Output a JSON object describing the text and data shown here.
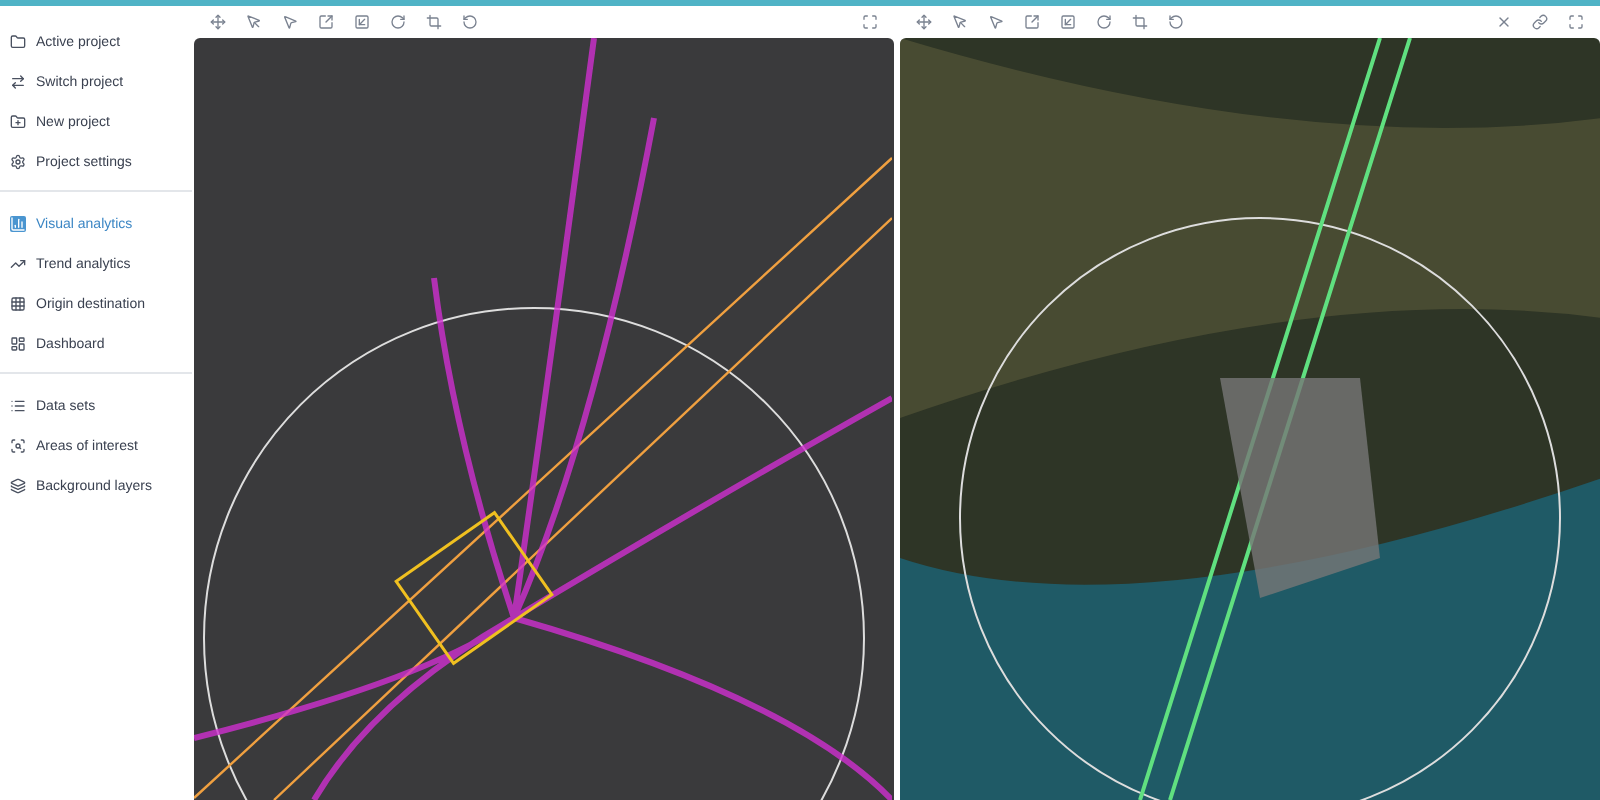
{
  "sidebar": {
    "sections": [
      [
        {
          "label": "Active project",
          "selected": false
        },
        {
          "label": "Switch project",
          "selected": false
        },
        {
          "label": "New project",
          "selected": false
        },
        {
          "label": "Project settings",
          "selected": false
        }
      ],
      [
        {
          "label": "Visual analytics",
          "selected": true
        },
        {
          "label": "Trend analytics",
          "selected": false
        },
        {
          "label": "Origin destination",
          "selected": false
        },
        {
          "label": "Dashboard",
          "selected": false
        }
      ],
      [
        {
          "label": "Data sets",
          "selected": false
        },
        {
          "label": "Areas of interest",
          "selected": false
        },
        {
          "label": "Background layers",
          "selected": false
        }
      ]
    ]
  },
  "panels": [
    {
      "kind": "street"
    },
    {
      "kind": "satellite"
    }
  ]
}
